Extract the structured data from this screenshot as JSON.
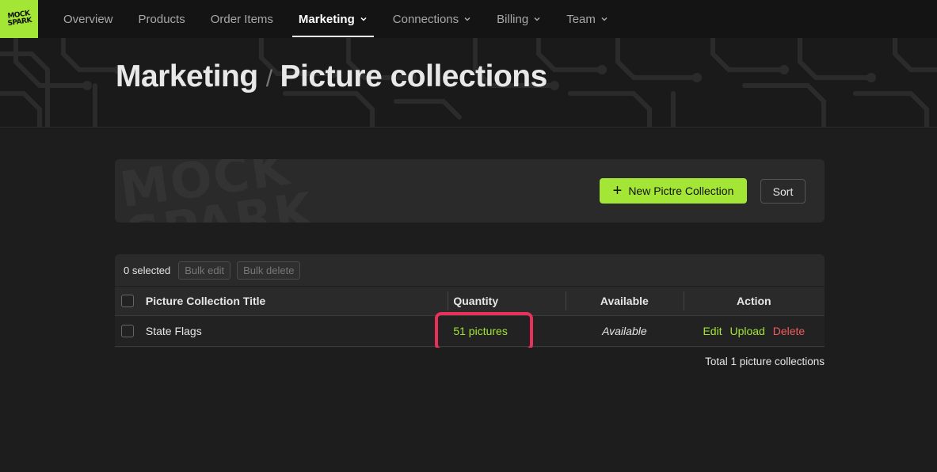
{
  "logo": {
    "text_line1": "MOCK",
    "text_line2": "SPARK",
    "icon": "mockspark-logo"
  },
  "nav": {
    "items": [
      {
        "label": "Overview",
        "dropdown": false,
        "active": false
      },
      {
        "label": "Products",
        "dropdown": false,
        "active": false
      },
      {
        "label": "Order Items",
        "dropdown": false,
        "active": false
      },
      {
        "label": "Marketing",
        "dropdown": true,
        "active": true
      },
      {
        "label": "Connections",
        "dropdown": true,
        "active": false
      },
      {
        "label": "Billing",
        "dropdown": true,
        "active": false
      },
      {
        "label": "Team",
        "dropdown": true,
        "active": false
      }
    ]
  },
  "header": {
    "breadcrumb_parent": "Marketing",
    "separator": "/",
    "title": "Picture collections"
  },
  "toolbar": {
    "watermark": "MOCK SPARK",
    "new_button_icon": "plus-icon",
    "new_button_label": "New Pictre Collection",
    "sort_label": "Sort"
  },
  "bulk": {
    "selected_text": "0 selected",
    "edit_label": "Bulk edit",
    "delete_label": "Bulk delete"
  },
  "table": {
    "columns": {
      "title": "Picture Collection Title",
      "quantity": "Quantity",
      "available": "Available",
      "action": "Action"
    },
    "rows": [
      {
        "title": "State Flags",
        "quantity": "51 pictures",
        "available": "Available",
        "actions": {
          "edit": "Edit",
          "upload": "Upload",
          "delete": "Delete"
        }
      }
    ]
  },
  "footer": {
    "total_text": "Total 1 picture collections"
  },
  "colors": {
    "accent": "#a3e635",
    "danger": "#f25c5c",
    "highlight": "#e8305a",
    "background": "#1d1d1d"
  }
}
